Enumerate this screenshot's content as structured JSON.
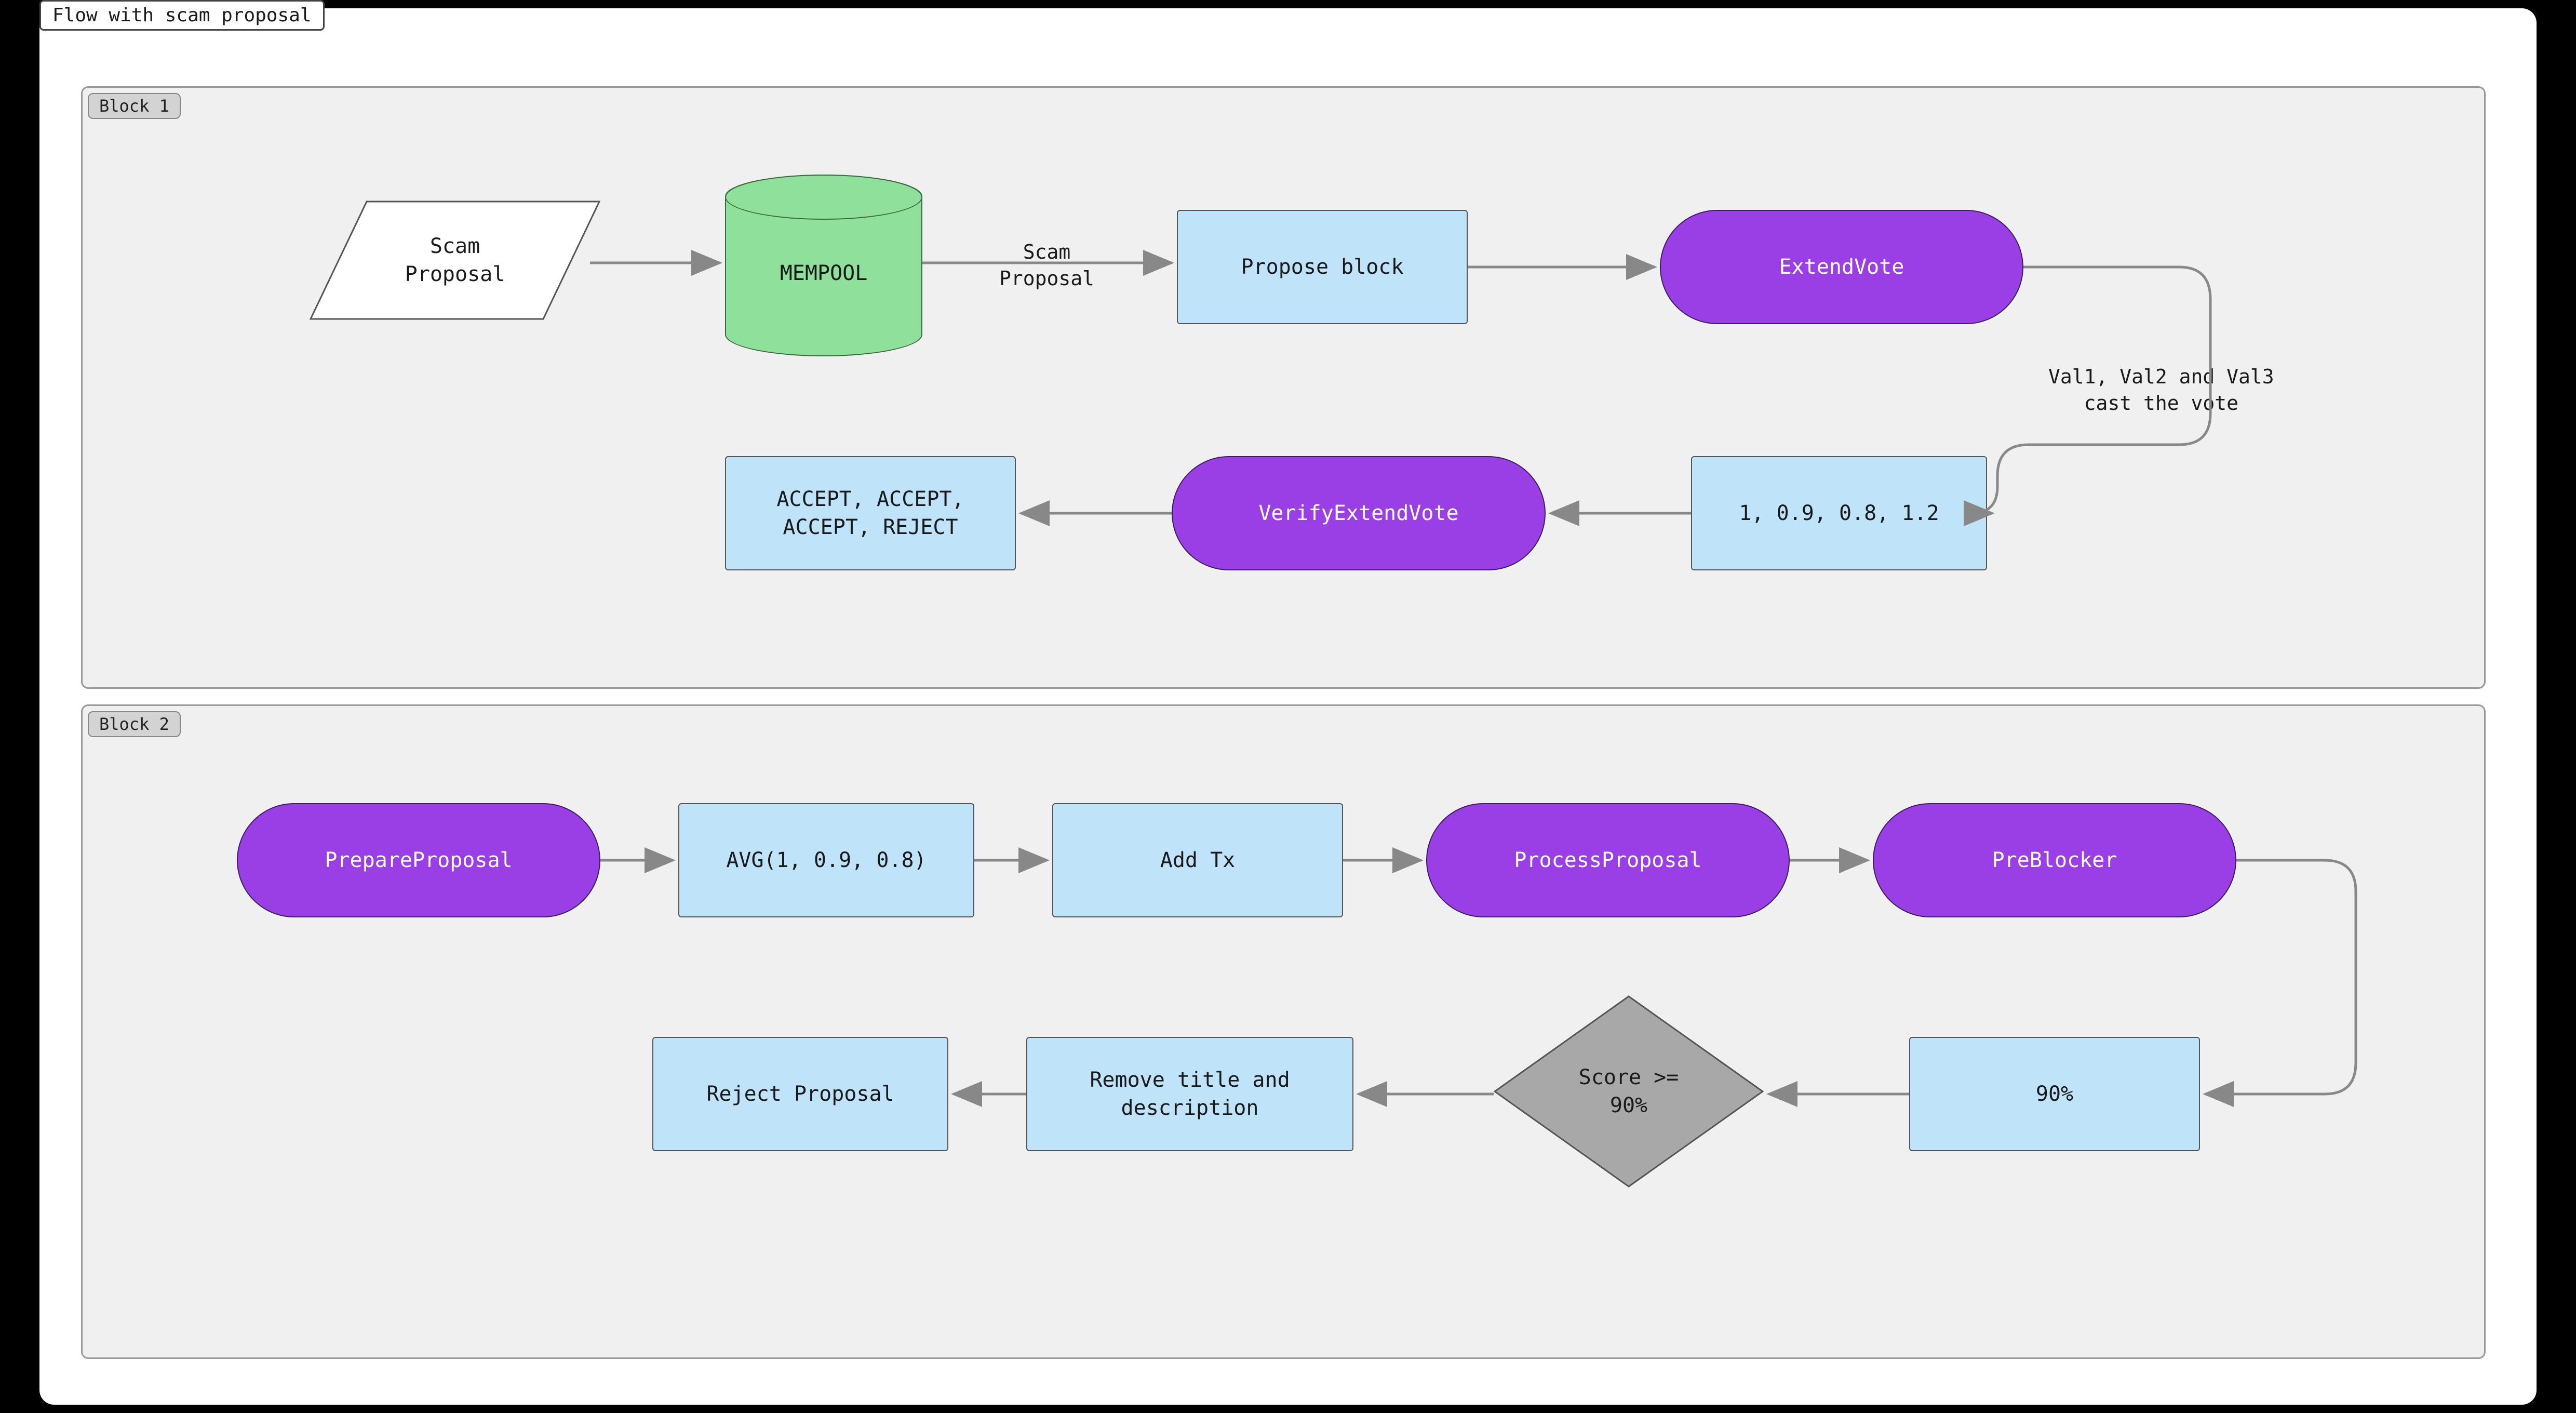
{
  "title": "Flow with scam proposal",
  "groups": {
    "block1": {
      "label": "Block 1"
    },
    "block2": {
      "label": "Block 2"
    }
  },
  "nodes": {
    "scam_proposal": "Scam\nProposal",
    "mempool": "MEMPOOL",
    "edge_scam_proposal": "Scam\nProposal",
    "propose_block": "Propose block",
    "extend_vote": "ExtendVote",
    "edge_val_cast": "Val1, Val2 and Val3\ncast the vote",
    "votes": "1, 0.9, 0.8, 1.2",
    "verify_extend_vote": "VerifyExtendVote",
    "accept_reject": "ACCEPT, ACCEPT,\nACCEPT, REJECT",
    "prepare_proposal": "PrepareProposal",
    "avg": "AVG(1, 0.9, 0.8)",
    "add_tx": "Add Tx",
    "process_proposal": "ProcessProposal",
    "pre_blocker": "PreBlocker",
    "ninety_pct": "90%",
    "score_ge": "Score >=\n90%",
    "remove_title": "Remove title and\ndescription",
    "reject_proposal": "Reject Proposal"
  },
  "chart_data": {
    "type": "diagram",
    "title": "Flow with scam proposal",
    "groups": [
      {
        "id": "block1",
        "label": "Block 1",
        "nodes": [
          {
            "id": "scam_proposal",
            "label": "Scam Proposal",
            "shape": "parallelogram",
            "style": "white"
          },
          {
            "id": "mempool",
            "label": "MEMPOOL",
            "shape": "cylinder",
            "style": "green"
          },
          {
            "id": "propose_block",
            "label": "Propose block",
            "shape": "rect",
            "style": "blue"
          },
          {
            "id": "extend_vote",
            "label": "ExtendVote",
            "shape": "stadium",
            "style": "purple"
          },
          {
            "id": "votes",
            "label": "1, 0.9, 0.8, 1.2",
            "shape": "rect",
            "style": "blue"
          },
          {
            "id": "verify_extend_vote",
            "label": "VerifyExtendVote",
            "shape": "stadium",
            "style": "purple"
          },
          {
            "id": "accept_reject",
            "label": "ACCEPT, ACCEPT, ACCEPT, REJECT",
            "shape": "rect",
            "style": "blue"
          }
        ],
        "edges": [
          {
            "from": "scam_proposal",
            "to": "mempool"
          },
          {
            "from": "mempool",
            "to": "propose_block",
            "label": "Scam Proposal"
          },
          {
            "from": "propose_block",
            "to": "extend_vote"
          },
          {
            "from": "extend_vote",
            "to": "votes",
            "label": "Val1, Val2 and Val3 cast the vote"
          },
          {
            "from": "votes",
            "to": "verify_extend_vote"
          },
          {
            "from": "verify_extend_vote",
            "to": "accept_reject"
          }
        ]
      },
      {
        "id": "block2",
        "label": "Block 2",
        "nodes": [
          {
            "id": "prepare_proposal",
            "label": "PrepareProposal",
            "shape": "stadium",
            "style": "purple"
          },
          {
            "id": "avg",
            "label": "AVG(1, 0.9, 0.8)",
            "shape": "rect",
            "style": "blue"
          },
          {
            "id": "add_tx",
            "label": "Add Tx",
            "shape": "rect",
            "style": "blue"
          },
          {
            "id": "process_proposal",
            "label": "ProcessProposal",
            "shape": "stadium",
            "style": "purple"
          },
          {
            "id": "pre_blocker",
            "label": "PreBlocker",
            "shape": "stadium",
            "style": "purple"
          },
          {
            "id": "ninety_pct",
            "label": "90%",
            "shape": "rect",
            "style": "blue"
          },
          {
            "id": "score_ge",
            "label": "Score >= 90%",
            "shape": "diamond",
            "style": "gray"
          },
          {
            "id": "remove_title",
            "label": "Remove title and description",
            "shape": "rect",
            "style": "blue"
          },
          {
            "id": "reject_proposal",
            "label": "Reject Proposal",
            "shape": "rect",
            "style": "blue"
          }
        ],
        "edges": [
          {
            "from": "prepare_proposal",
            "to": "avg"
          },
          {
            "from": "avg",
            "to": "add_tx"
          },
          {
            "from": "add_tx",
            "to": "process_proposal"
          },
          {
            "from": "process_proposal",
            "to": "pre_blocker"
          },
          {
            "from": "pre_blocker",
            "to": "ninety_pct"
          },
          {
            "from": "ninety_pct",
            "to": "score_ge"
          },
          {
            "from": "score_ge",
            "to": "remove_title"
          },
          {
            "from": "remove_title",
            "to": "reject_proposal"
          }
        ]
      }
    ]
  }
}
